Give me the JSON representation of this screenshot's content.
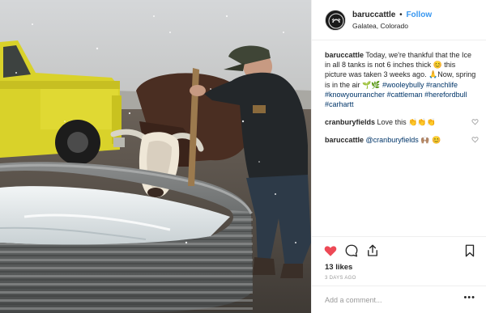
{
  "post": {
    "image_alt": "Farmer breaking ice in a stock tank while a Hereford bull drinks, yellow truck behind",
    "username": "baruccattle",
    "dot": "•",
    "follow_label": "Follow",
    "location": "Galatea, Colorado"
  },
  "caption": {
    "user": "baruccattle",
    "text_1": "Today, we're thankful that the Ice in all 8 tanks is not 6 inches thick 😊 this picture was taken 3 weeks ago. 🙏Now, spring is in the air 🌱🌿",
    "tags": [
      "#wooleybully",
      "#ranchlife",
      "#knowyourrancher",
      "#cattleman",
      "#herefordbull",
      "#carhartt"
    ]
  },
  "comments": [
    {
      "user": "cranburyfields",
      "text": "Love this 👏👏👏"
    },
    {
      "user": "baruccattle",
      "mention": "@cranburyfields",
      "text": "🙌🏽 😊"
    }
  ],
  "actions": {
    "icons": [
      "heart-icon",
      "comment-icon",
      "share-icon",
      "bookmark-icon"
    ],
    "liked_color": "#ed4956",
    "likes": "13 likes",
    "time_ago": "3 DAYS AGO",
    "comment_placeholder": "Add a comment...",
    "more": "•••"
  }
}
